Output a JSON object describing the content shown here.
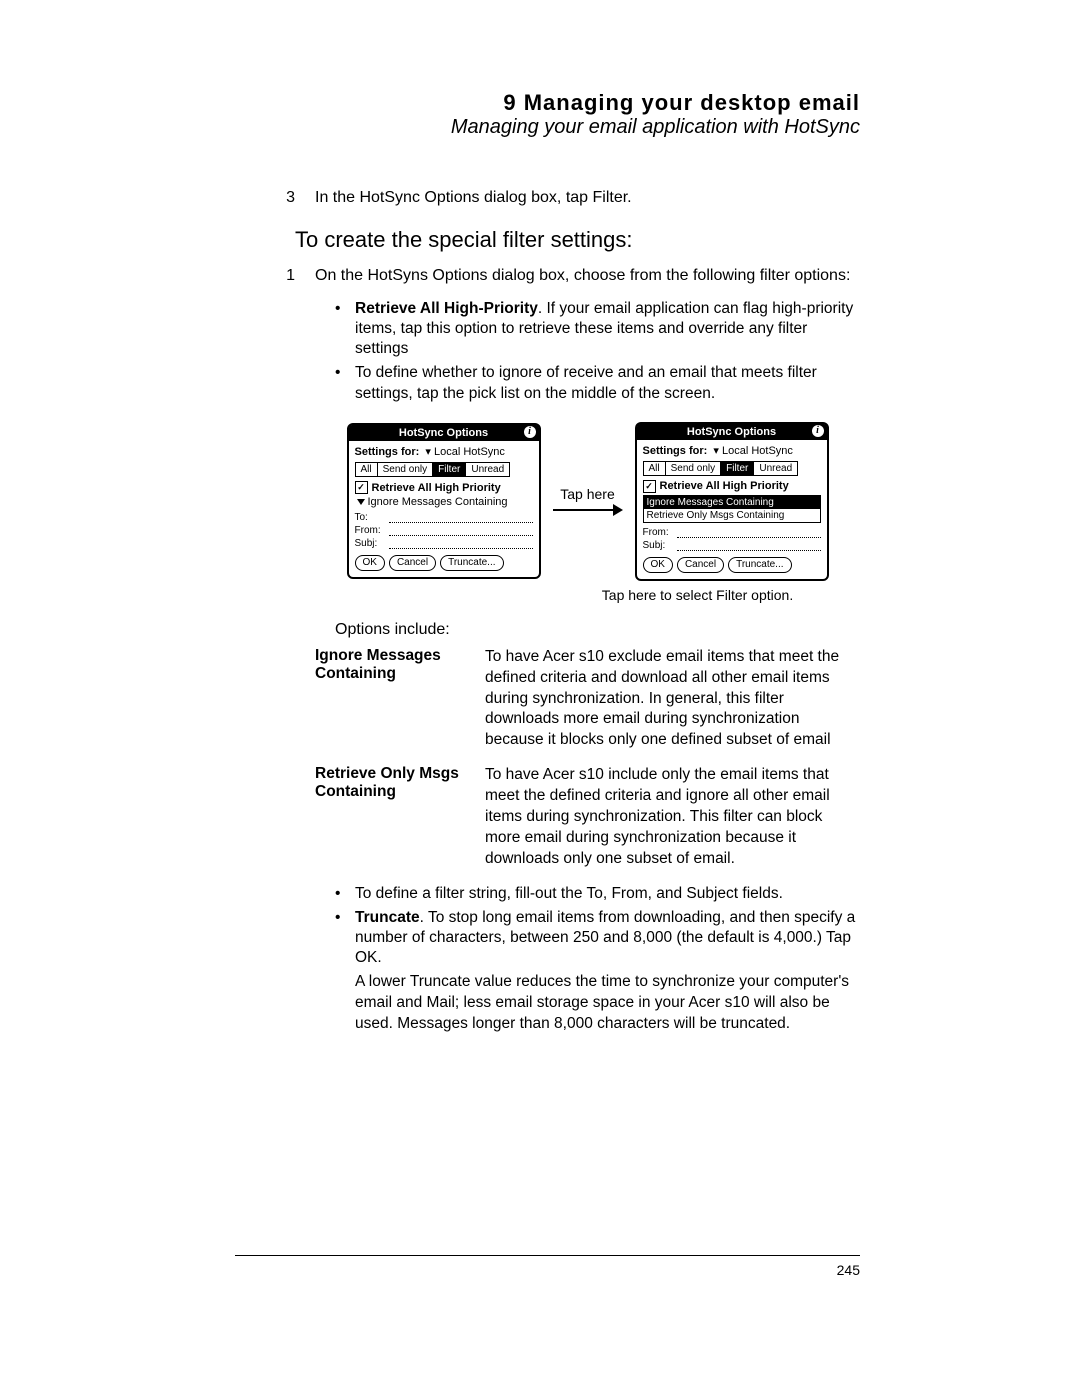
{
  "header": {
    "chapter": "9 Managing your desktop email",
    "subtitle": "Managing your email application with HotSync"
  },
  "step3": {
    "num": "3",
    "text": "In the HotSync Options dialog box, tap Filter."
  },
  "section_heading": "To create the special filter settings:",
  "step1": {
    "num": "1",
    "text": "On the HotSyns Options dialog box, choose from the following filter options:"
  },
  "bullets1": {
    "a_bold": "Retrieve All High-Priority",
    "a_rest": ". If your email application can flag high-priority items, tap this option to retrieve these items and override any filter settings",
    "b": "To define whether to ignore of receive and an email that meets filter settings, tap the pick list on the middle of the screen."
  },
  "fig": {
    "title": "HotSync Options",
    "settings_label": "Settings for:",
    "settings_value": "Local HotSync",
    "tabs": {
      "all": "All",
      "send": "Send only",
      "filter": "Filter",
      "unread": "Unread"
    },
    "retrieve": "Retrieve All High Priority",
    "picklist_left": "Ignore Messages Containing",
    "dd_opt1": "Ignore Messages Containing",
    "dd_opt2": "Retrieve Only Msgs Containing",
    "to": "To:",
    "from": "From:",
    "subj": "Subj:",
    "ok": "OK",
    "cancel": "Cancel",
    "truncate": "Truncate...",
    "tap_here": "Tap here",
    "caption_right": "Tap here to select Filter option."
  },
  "options_include": "Options include:",
  "defs": {
    "t1": "Ignore Messages Containing",
    "d1": "To have Acer s10 exclude email items that meet the defined criteria and download all other email items during synchronization. In general, this filter downloads more email during synchronization because it blocks only one defined subset of email",
    "t2": "Retrieve Only Msgs Containing",
    "d2": "To have Acer s10 include only the email items that meet the defined criteria and ignore all other email items during synchronization. This filter can block more email during synchronization because it downloads only one subset of email."
  },
  "bullets2": {
    "a": "To define a filter string, fill-out the To, From, and Subject fields.",
    "b_bold": "Truncate",
    "b_rest": ". To stop long email items from downloading, and then specify a number of characters, between 250 and 8,000 (the default is 4,000.) Tap OK.",
    "extra": "A lower Truncate value reduces the time to synchronize your computer's email and Mail; less email storage space in your Acer s10 will also be used. Messages longer than 8,000 characters will be truncated."
  },
  "page_number": "245"
}
